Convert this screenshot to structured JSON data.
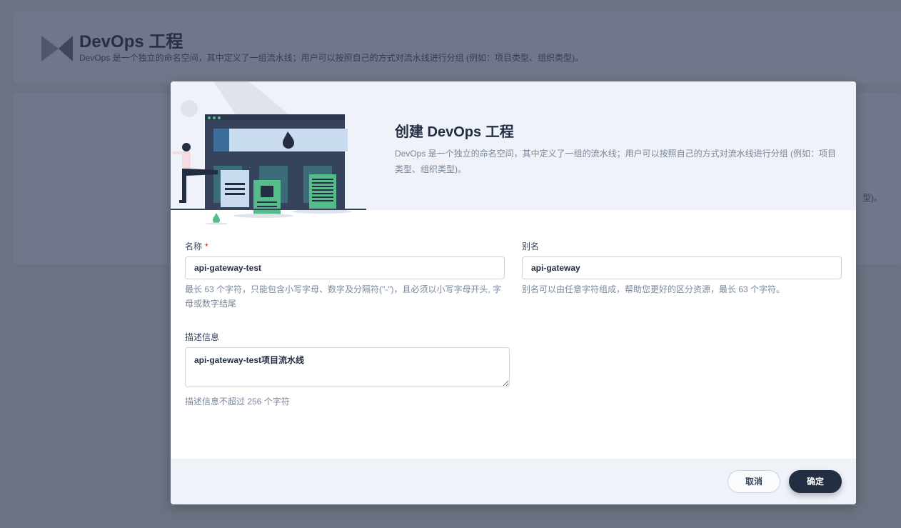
{
  "background": {
    "title": "DevOps 工程",
    "description": "DevOps 是一个独立的命名空间，其中定义了一组流水线；用户可以按照自己的方式对流水线进行分组 (例如：项目类型、组织类型)。",
    "panel_fragment": "型)。"
  },
  "modal": {
    "title": "创建 DevOps 工程",
    "description": "DevOps 是一个独立的命名空间，其中定义了一组的流水线；用户可以按照自己的方式对流水线进行分组 (例如：项目类型、组织类型)。",
    "name_field": {
      "label": "名称",
      "required_mark": "*",
      "value": "api-gateway-test",
      "hint": "最长 63 个字符，只能包含小写字母、数字及分隔符(\"-\")，且必须以小写字母开头, 字母或数字结尾"
    },
    "alias_field": {
      "label": "别名",
      "value": "api-gateway",
      "hint": "别名可以由任意字符组成，帮助您更好的区分资源，最长 63 个字符。"
    },
    "desc_field": {
      "label": "描述信息",
      "value": "api-gateway-test项目流水线",
      "hint": "描述信息不超过 256 个字符"
    },
    "buttons": {
      "cancel": "取消",
      "ok": "确定"
    }
  },
  "colors": {
    "primary_dark": "#242e42",
    "accent_green": "#55bc8a",
    "header_bg": "#eff2f8"
  }
}
